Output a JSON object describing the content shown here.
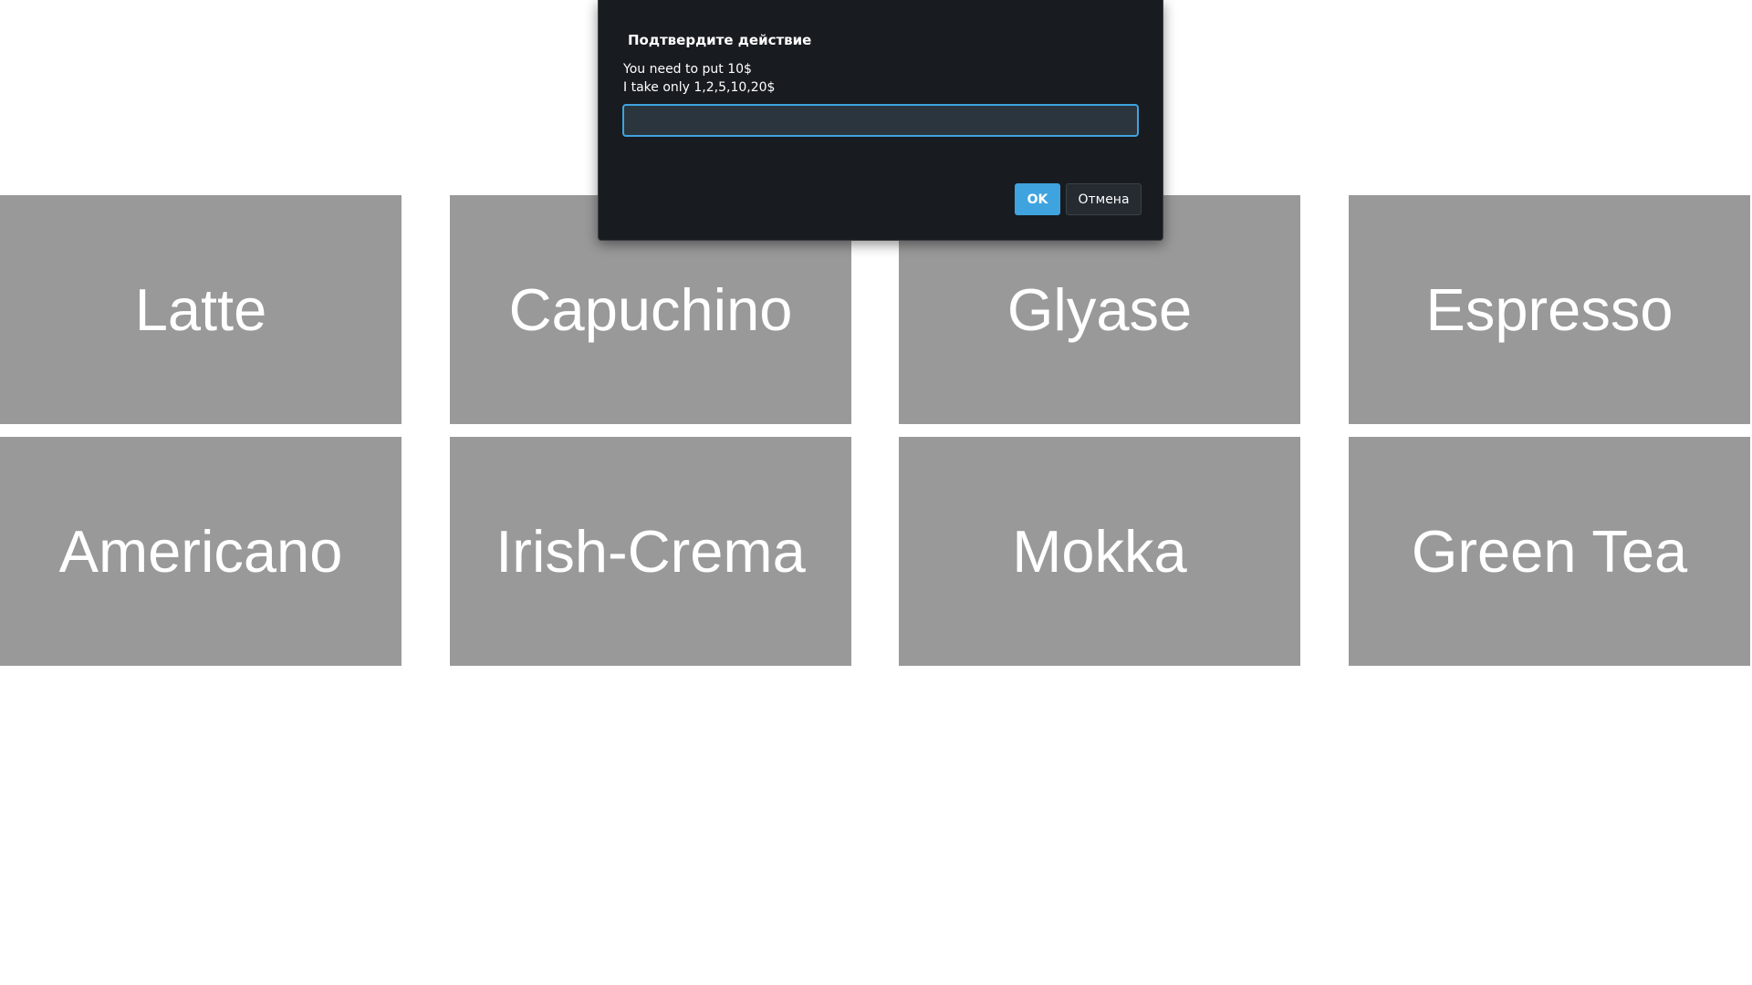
{
  "menu": {
    "items": [
      {
        "label": "Latte"
      },
      {
        "label": "Capuchino"
      },
      {
        "label": "Glyase"
      },
      {
        "label": "Espresso"
      },
      {
        "label": "Americano"
      },
      {
        "label": "Irish-Crema"
      },
      {
        "label": "Mokka"
      },
      {
        "label": "Green Tea"
      }
    ]
  },
  "dialog": {
    "title": "Подтвердите действие",
    "message_lines": [
      "You need to put 10$",
      "I take only 1,2,5,10,20$"
    ],
    "input_value": "",
    "ok_label": "OK",
    "cancel_label": "Отмена"
  },
  "colors": {
    "tile_bg": "#999999",
    "tile_text": "#ffffff",
    "dialog_bg": "#181c20",
    "accent": "#3fa3df"
  }
}
